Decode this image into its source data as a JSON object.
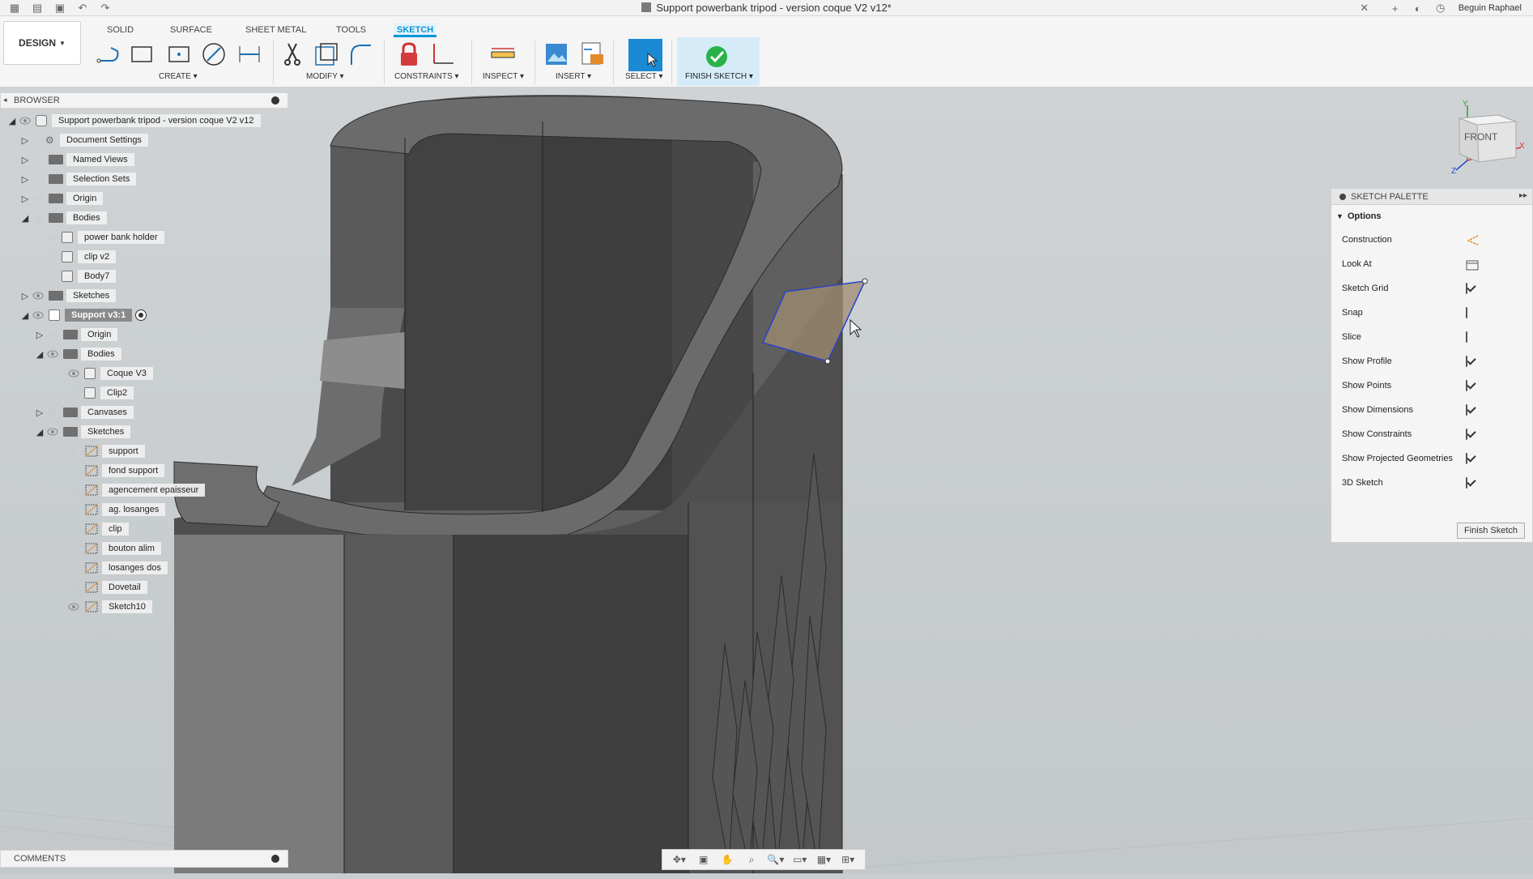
{
  "titlebar": {
    "title": "Support powerbank tripod - version coque V2 v12*",
    "user": "Beguin Raphael"
  },
  "toolbar": {
    "workspace": "DESIGN",
    "tabs": [
      {
        "label": "SOLID"
      },
      {
        "label": "SURFACE"
      },
      {
        "label": "SHEET METAL"
      },
      {
        "label": "TOOLS"
      },
      {
        "label": "SKETCH",
        "active": true
      }
    ],
    "groups": {
      "create": "CREATE",
      "modify": "MODIFY",
      "constraints": "CONSTRAINTS",
      "inspect": "INSPECT",
      "insert": "INSERT",
      "select": "SELECT",
      "finish": "FINISH SKETCH"
    },
    "accent": "#0696d7"
  },
  "browser": {
    "header": "BROWSER",
    "items": [
      {
        "label": "Support powerbank tripod - version coque V2 v12"
      },
      {
        "label": "Document Settings"
      },
      {
        "label": "Named Views"
      },
      {
        "label": "Selection Sets"
      },
      {
        "label": "Origin"
      },
      {
        "label": "Bodies"
      },
      {
        "label": "power bank holder"
      },
      {
        "label": "clip v2"
      },
      {
        "label": "Body7"
      },
      {
        "label": "Sketches"
      },
      {
        "label": "Support v3:1"
      },
      {
        "label": "Origin"
      },
      {
        "label": "Bodies"
      },
      {
        "label": "Coque V3"
      },
      {
        "label": "Clip2"
      },
      {
        "label": "Canvases"
      },
      {
        "label": "Sketches"
      },
      {
        "label": "support"
      },
      {
        "label": "fond support"
      },
      {
        "label": "agencement epaisseur"
      },
      {
        "label": "ag. losanges"
      },
      {
        "label": "clip"
      },
      {
        "label": "bouton alim"
      },
      {
        "label": "losanges dos"
      },
      {
        "label": "Dovetail"
      },
      {
        "label": "Sketch10"
      }
    ]
  },
  "comments": {
    "label": "COMMENTS"
  },
  "viewcube": {
    "face": "FRONT",
    "x_axis": "X",
    "y_axis": "Y",
    "z_axis": "Z"
  },
  "palette": {
    "header": "SKETCH PALETTE",
    "section": "Options",
    "rows": [
      {
        "label": "Construction"
      },
      {
        "label": "Look At"
      },
      {
        "label": "Sketch Grid",
        "checked": true
      },
      {
        "label": "Snap",
        "checked": false
      },
      {
        "label": "Slice",
        "checked": false
      },
      {
        "label": "Show Profile",
        "checked": true
      },
      {
        "label": "Show Points",
        "checked": true
      },
      {
        "label": "Show Dimensions",
        "checked": true
      },
      {
        "label": "Show Constraints",
        "checked": true
      },
      {
        "label": "Show Projected Geometries",
        "checked": true
      },
      {
        "label": "3D Sketch",
        "checked": true
      }
    ],
    "finish_button": "Finish Sketch"
  }
}
